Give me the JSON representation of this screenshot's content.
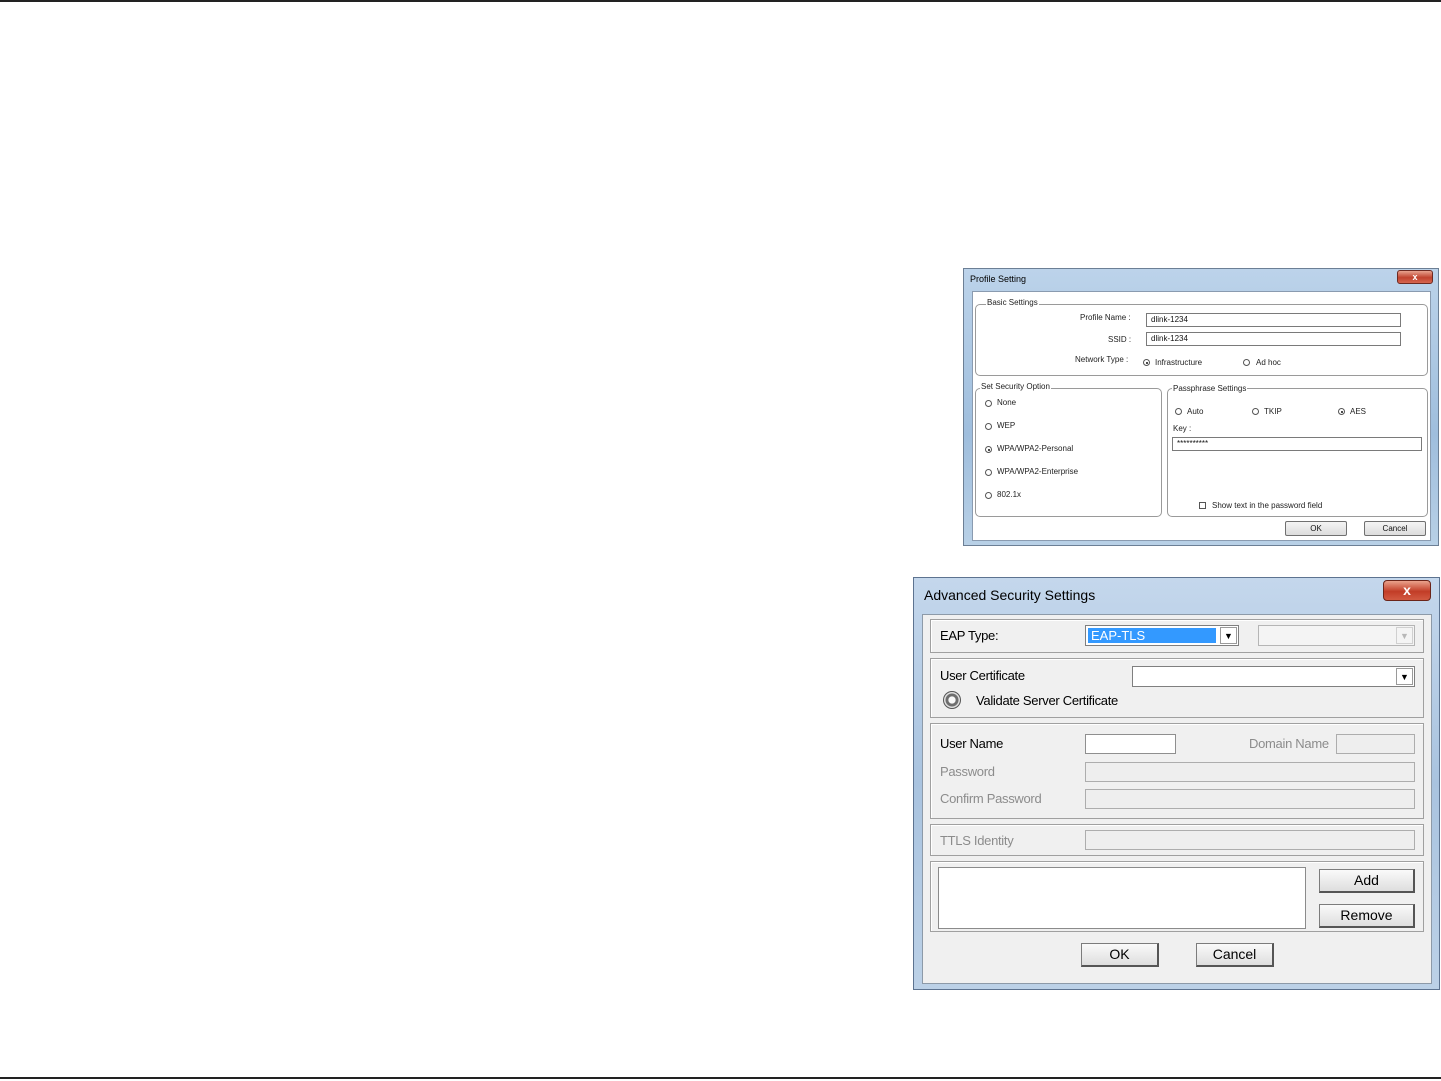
{
  "profile_setting": {
    "title": "Profile Setting",
    "close_label": "x",
    "basic": {
      "legend": "Basic Settings",
      "profile_name_label": "Profile Name :",
      "profile_name_value": "dlink-1234",
      "ssid_label": "SSID :",
      "ssid_value": "dlink-1234",
      "network_type_label": "Network Type :",
      "network_types": [
        "Infrastructure",
        "Ad hoc"
      ],
      "network_type_selected": "Infrastructure"
    },
    "security": {
      "legend": "Set Security Option",
      "options": [
        "None",
        "WEP",
        "WPA/WPA2-Personal",
        "WPA/WPA2-Enterprise",
        "802.1x"
      ],
      "selected": "WPA/WPA2-Personal"
    },
    "passphrase": {
      "legend": "Passphrase Settings",
      "encryption": [
        "Auto",
        "TKIP",
        "AES"
      ],
      "encryption_selected": "AES",
      "key_label": "Key :",
      "key_value": "**********",
      "show_text_label": "Show text in the password field",
      "show_text_checked": false
    },
    "ok_label": "OK",
    "cancel_label": "Cancel"
  },
  "advanced_security": {
    "title": "Advanced Security Settings",
    "close_label": "x",
    "eap_type_label": "EAP Type:",
    "eap_type_value": "EAP-TLS",
    "secondary_value": "",
    "user_certificate_label": "User Certificate",
    "user_certificate_value": "",
    "validate_server_label": "Validate Server Certificate",
    "user_name_label": "User Name",
    "user_name_value": "",
    "domain_name_label": "Domain Name",
    "domain_name_value": "",
    "password_label": "Password",
    "confirm_password_label": "Confirm Password",
    "ttls_identity_label": "TTLS Identity",
    "add_label": "Add",
    "remove_label": "Remove",
    "ok_label": "OK",
    "cancel_label": "Cancel"
  },
  "colors": {
    "titlebar": "#a9c3df",
    "close_button": "#c23d27",
    "selection": "#3399ff"
  }
}
